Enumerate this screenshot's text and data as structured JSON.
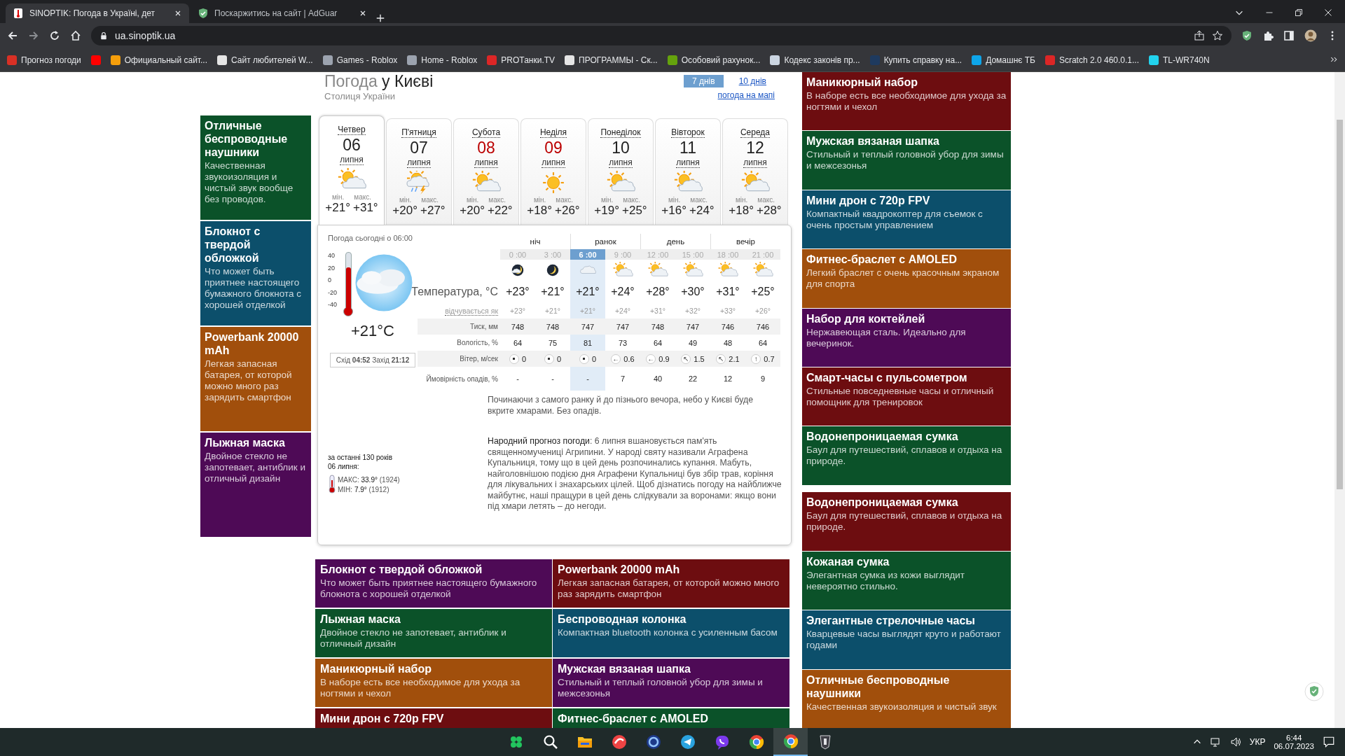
{
  "browser": {
    "tabs": [
      {
        "title": "SINOPTIK: Погода в Україні, дет",
        "kind": "sinoptik",
        "selected": true
      },
      {
        "title": "Поскаржитись на сайт | AdGuar",
        "kind": "shield",
        "selected": false
      }
    ],
    "url": "ua.sinoptik.ua",
    "bookmarks": [
      {
        "label": "Прогноз погоди",
        "color": "#d93025"
      },
      {
        "color": "#ff0000"
      },
      {
        "label": "Официальный сайт...",
        "color": "#f59e0b"
      },
      {
        "label": "Сайт любителей W...",
        "color": "#e5e5e5"
      },
      {
        "label": "Games - Roblox",
        "color": "#9ca3af"
      },
      {
        "label": "Home - Roblox",
        "color": "#9ca3af"
      },
      {
        "label": "PROТанки.TV",
        "color": "#dc2626"
      },
      {
        "label": "ПРОГРАММЫ - Ск...",
        "color": "#e5e5e5"
      },
      {
        "label": "Особовий рахунок...",
        "color": "#65a30d"
      },
      {
        "label": "Кодекс законів пр...",
        "color": "#cbd5e1"
      },
      {
        "label": "Купить справку на...",
        "color": "#1e3a5f"
      },
      {
        "label": "Домашнє ТБ",
        "color": "#0ea5e9"
      },
      {
        "label": "Scratch 2.0 460.0.1...",
        "color": "#dc2626"
      },
      {
        "label": "TL-WR740N",
        "color": "#22d3ee"
      }
    ]
  },
  "left_ads": [
    {
      "title": "Отличные беспроводные наушники",
      "description": "Качественная звукоизоляция и чистый звук вообще без проводов.",
      "color": "#0b5229"
    },
    {
      "title": "Блокнот с твердой обложкой",
      "description": "Что может быть приятнее настоящего бумажного блокнота с хорошей отделкой",
      "color": "#0c4f6b"
    },
    {
      "title": "Powerbank 20000 mAh",
      "description": "Легкая запасная батарея, от которой можно много раз зарядить смартфон",
      "color": "#a14f0c"
    },
    {
      "title": "Лыжная маска",
      "description": "Двойное стекло не запотевает, антиблик и отличный дизайн",
      "color": "#4e0a56"
    }
  ],
  "weather": {
    "title_light": "Погода",
    "title_dark": "у Києві",
    "subtitle": "Столиця України",
    "range_tabs": [
      {
        "label": "7 днів",
        "selected": true
      },
      {
        "label": "10 днів",
        "selected": false
      }
    ],
    "map_link": "погода на мапі",
    "days": [
      {
        "weekday": "Четвер",
        "date": "06",
        "month": "липня",
        "kind": "sun-cloud",
        "min_label": "мін.",
        "max_label": "макс.",
        "min": "+21°",
        "max": "+31°",
        "weekend": false,
        "selected": true
      },
      {
        "weekday": "П'ятниця",
        "date": "07",
        "month": "липня",
        "kind": "storm",
        "min_label": "мін.",
        "max_label": "макс.",
        "min": "+20°",
        "max": "+27°",
        "weekend": false,
        "selected": false
      },
      {
        "weekday": "Субота",
        "date": "08",
        "month": "липня",
        "kind": "sun-cloud",
        "min_label": "мін.",
        "max_label": "макс.",
        "min": "+20°",
        "max": "+22°",
        "weekend": true,
        "selected": false
      },
      {
        "weekday": "Неділя",
        "date": "09",
        "month": "липня",
        "kind": "sun",
        "min_label": "мін.",
        "max_label": "макс.",
        "min": "+18°",
        "max": "+26°",
        "weekend": true,
        "selected": false
      },
      {
        "weekday": "Понеділок",
        "date": "10",
        "month": "липня",
        "kind": "sun-cloud",
        "min_label": "мін.",
        "max_label": "макс.",
        "min": "+19°",
        "max": "+25°",
        "weekend": false,
        "selected": false
      },
      {
        "weekday": "Вівторок",
        "date": "11",
        "month": "липня",
        "kind": "sun-cloud",
        "min_label": "мін.",
        "max_label": "макс.",
        "min": "+16°",
        "max": "+24°",
        "weekend": false,
        "selected": false
      },
      {
        "weekday": "Середа",
        "date": "12",
        "month": "липня",
        "kind": "sun-cloud",
        "min_label": "мін.",
        "max_label": "макс.",
        "min": "+18°",
        "max": "+28°",
        "weekend": false,
        "selected": false
      }
    ],
    "now": {
      "heading": "Погода сьогодні о 06:00",
      "scale": [
        "40",
        "20",
        "0",
        "-20",
        "-40"
      ],
      "level": 0.77,
      "temperature": "+21°C",
      "sun": "Схід **04:52** Захід **21:12**"
    },
    "row_labels": {
      "temp": "Температура, °C",
      "feels": "відчувається як",
      "pressure": "Тиск, мм",
      "humidity": "Вологість, %",
      "wind": "Вітер, м/сек",
      "precip": "Ймовірність опадів, %"
    },
    "periods": [
      {
        "label": "ніч"
      },
      {
        "label": "ранок"
      },
      {
        "label": "день"
      },
      {
        "label": "вечір"
      }
    ],
    "hours": [
      {
        "time": "0 :00",
        "selected": false,
        "kind": "moon-cloud",
        "temp": "+23°",
        "feels": "+23°",
        "pressure": "748",
        "humidity": "64",
        "wind": "0",
        "precip": "-"
      },
      {
        "time": "3 :00",
        "selected": false,
        "kind": "moon",
        "temp": "+21°",
        "feels": "+21°",
        "pressure": "748",
        "humidity": "75",
        "wind": "0",
        "precip": "-"
      },
      {
        "time": "6 :00",
        "selected": true,
        "kind": "cloud",
        "temp": "+21°",
        "feels": "+21°",
        "pressure": "747",
        "humidity": "81",
        "wind": "0",
        "precip": "-"
      },
      {
        "time": "9 :00",
        "selected": false,
        "kind": "sun-cloud",
        "temp": "+24°",
        "feels": "+24°",
        "pressure": "747",
        "humidity": "73",
        "wind_arrow": "←",
        "wind": "0.6",
        "precip": "7"
      },
      {
        "time": "12 :00",
        "selected": false,
        "kind": "sun-cloud",
        "temp": "+28°",
        "feels": "+31°",
        "pressure": "748",
        "humidity": "64",
        "wind_arrow": "←",
        "wind": "0.9",
        "precip": "40"
      },
      {
        "time": "15 :00",
        "selected": false,
        "kind": "sun-cloud",
        "temp": "+30°",
        "feels": "+32°",
        "pressure": "747",
        "humidity": "49",
        "wind_arrow": "↖",
        "wind": "1.5",
        "precip": "22"
      },
      {
        "time": "18 :00",
        "selected": false,
        "kind": "sun-cloud",
        "temp": "+31°",
        "feels": "+33°",
        "pressure": "746",
        "humidity": "48",
        "wind_arrow": "↖",
        "wind": "2.1",
        "precip": "12"
      },
      {
        "time": "21 :00",
        "selected": false,
        "kind": "sun-cloud",
        "temp": "+25°",
        "feels": "+26°",
        "pressure": "746",
        "humidity": "64",
        "wind_arrow": "↑",
        "wind": "0.7",
        "precip": "9"
      }
    ],
    "description": "Починаючи з самого ранку й до пізнього вечора, небо у Києві буде вкрите хмарами. Без опадів.",
    "history": {
      "heading": "за останні 130 років",
      "date": "06 липня:",
      "max": "МАКС: **33.9°** (1924)",
      "min": "МІН: **7.9°** (1912)"
    },
    "folk": "**Народний прогноз погоди**: 6 липня вшановується пам'ять священномучениці Агрипини. У народі святу називали Аграфена Купальниця, тому що в цей день розпочинались купання. Мабуть, найголовнішою подією дня Аграфени Купальниці був збір трав, коріння для лікувальних і знахарських цілей. Щоб дізнатись погоду на найближче майбутнє, наші пращури в цей день слідкували за воронами: якщо вони під хмари летять – до негоди."
  },
  "bottom_ads": [
    {
      "title": "Блокнот с твердой обложкой",
      "description": "Что может быть приятнее настоящего бумажного блокнота с хорошей отделкой",
      "color": "#4e0a56"
    },
    {
      "title": "Powerbank 20000 mAh",
      "description": "Легкая запасная батарея, от которой можно много раз зарядить смартфон",
      "color": "#6d0d10"
    },
    {
      "title": "Лыжная маска",
      "description": "Двойное стекло не запотевает, антиблик и отличный дизайн",
      "color": "#0b5229"
    },
    {
      "title": "Беспроводная колонка",
      "description": "Компактная bluetooth колонка с усиленным басом",
      "color": "#0c4f6b"
    },
    {
      "title": "Маникюрный набор",
      "description": "В наборе есть все необходимое для ухода за ногтями и чехол",
      "color": "#a14f0c"
    },
    {
      "title": "Мужская вязаная шапка",
      "description": "Стильный и теплый головной убор для зимы и межсезонья",
      "color": "#4e0a56"
    },
    {
      "title": "Мини дрон с 720p FPV",
      "color": "#6d0d10"
    },
    {
      "title": "Фитнес-браслет с AMOLED",
      "color": "#0b5229"
    }
  ],
  "right_ads": [
    {
      "title": "Маникюрный набор",
      "description": "В наборе есть все необходимое для ухода за ногтями и чехол",
      "color": "#6d0d10"
    },
    {
      "title": "Мужская вязаная шапка",
      "description": "Стильный и теплый головной убор для зимы и межсезонья",
      "color": "#0b5229"
    },
    {
      "title": "Мини дрон с 720p FPV",
      "description": "Компактный квадрокоптер для съемок с очень простым управлением",
      "color": "#0c4f6b"
    },
    {
      "title": "Фитнес-браслет с AMOLED",
      "description": "Легкий браслет с очень красочным экраном для спорта",
      "color": "#a14f0c"
    },
    {
      "title": "Набор для коктейлей",
      "description": "Нержавеющая сталь. Идеально для вечеринок.",
      "color": "#4e0a56"
    },
    {
      "title": "Смарт-часы с пульсометром",
      "description": "Стильные повседневные часы и отличный помощник для тренировок",
      "color": "#6d0d10"
    },
    {
      "title": "Водонепроницаемая сумка",
      "description": "Баул для путешествий, сплавов и отдыха на природе.",
      "color": "#0b5229"
    },
    {
      "title": "Водонепроницаемая сумка",
      "description": "Баул для путешествий, сплавов и отдыха на природе.",
      "color": "#6d0d10"
    },
    {
      "title": "Кожаная сумка",
      "description": "Элегантная сумка из кожи выглядит невероятно стильно.",
      "color": "#0b5229"
    },
    {
      "title": "Элегантные стрелочные часы",
      "description": "Кварцевые часы выглядят круто и работают годами",
      "color": "#0c4f6b"
    },
    {
      "title": "Отличные беспроводные наушники",
      "description": "Качественная звукоизоляция и чистый звук",
      "color": "#a14f0c"
    }
  ],
  "taskbar": {
    "apps": [
      {
        "kind": "clover",
        "selected": false
      },
      {
        "kind": "search",
        "selected": false
      },
      {
        "kind": "folder",
        "selected": false
      },
      {
        "kind": "red-round",
        "selected": false
      },
      {
        "kind": "ring",
        "selected": false
      },
      {
        "kind": "telegram",
        "selected": false
      },
      {
        "kind": "viber",
        "selected": false
      },
      {
        "kind": "chrome",
        "selected": false
      },
      {
        "kind": "chrome",
        "selected": true
      },
      {
        "kind": "tank",
        "selected": false
      }
    ],
    "language": "УКР",
    "time": "6:44",
    "date": "06.07.2023"
  }
}
